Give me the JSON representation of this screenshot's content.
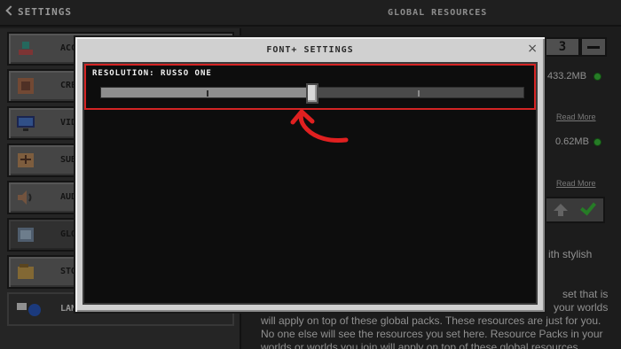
{
  "header": {
    "back_label": "SETTINGS",
    "title": "GLOBAL RESOURCES"
  },
  "sidebar": {
    "items": [
      {
        "label": "ACCE",
        "icon": "accessibility-icon"
      },
      {
        "label": "CRE",
        "icon": "creator-icon"
      },
      {
        "label": "VIDE",
        "icon": "video-icon"
      },
      {
        "label": "SUB",
        "icon": "subtitles-icon"
      },
      {
        "label": "AUD",
        "icon": "audio-icon"
      },
      {
        "label": "GLO",
        "icon": "global-resources-icon"
      },
      {
        "label": "STO",
        "icon": "storage-icon"
      },
      {
        "label": "LANGUAGE",
        "icon": "language-icon"
      }
    ]
  },
  "content": {
    "counter": "3",
    "pack1_size": "433.2MB",
    "pack2_size": "0.62MB",
    "read_more_1": "Read More",
    "read_more_2": "Read More",
    "stylish_text": "ith stylish",
    "set_that_text": "set that is",
    "your_worlds_text": "your worlds",
    "desc_line1": "will apply on top of these global packs. These resources are just for you.",
    "desc_line2": "No one else will see the resources you set here. Resource Packs in your",
    "desc_line3": "worlds or worlds you join will apply on top of these global resources"
  },
  "modal": {
    "title": "FONT+ SETTINGS",
    "close": "×",
    "resolution_label": "RESOLUTION: RUSSO ONE",
    "slider_fraction": 0.5,
    "slider_ticks": [
      0.25,
      0.75
    ],
    "highlight_color": "#d42424"
  }
}
